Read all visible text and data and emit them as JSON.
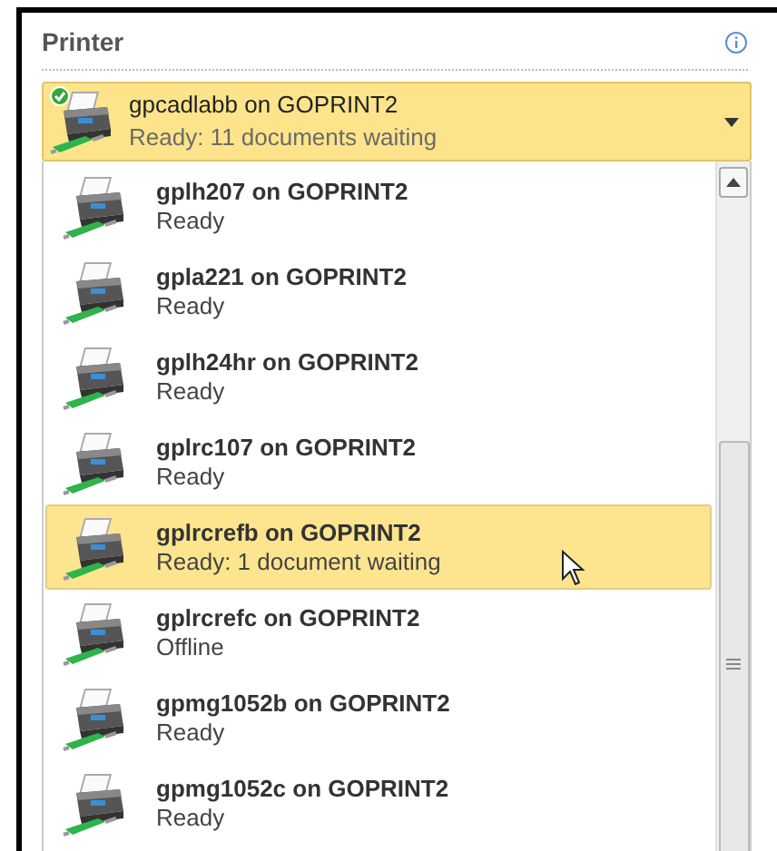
{
  "section": {
    "title": "Printer"
  },
  "current_printer": {
    "name": "gpcadlabb on GOPRINT2",
    "status": "Ready: 11 documents waiting",
    "default": true
  },
  "printers": [
    {
      "name": "gplh207 on GOPRINT2",
      "status": "Ready",
      "selected": false
    },
    {
      "name": "gpla221 on GOPRINT2",
      "status": "Ready",
      "selected": false
    },
    {
      "name": "gplh24hr on GOPRINT2",
      "status": "Ready",
      "selected": false
    },
    {
      "name": "gplrc107 on GOPRINT2",
      "status": "Ready",
      "selected": false
    },
    {
      "name": "gplrcrefb on GOPRINT2",
      "status": "Ready: 1 document waiting",
      "selected": true
    },
    {
      "name": "gplrcrefc on GOPRINT2",
      "status": "Offline",
      "selected": false
    },
    {
      "name": "gpmg1052b on GOPRINT2",
      "status": "Ready",
      "selected": false
    },
    {
      "name": "gpmg1052c on GOPRINT2",
      "status": "Ready",
      "selected": false
    }
  ]
}
